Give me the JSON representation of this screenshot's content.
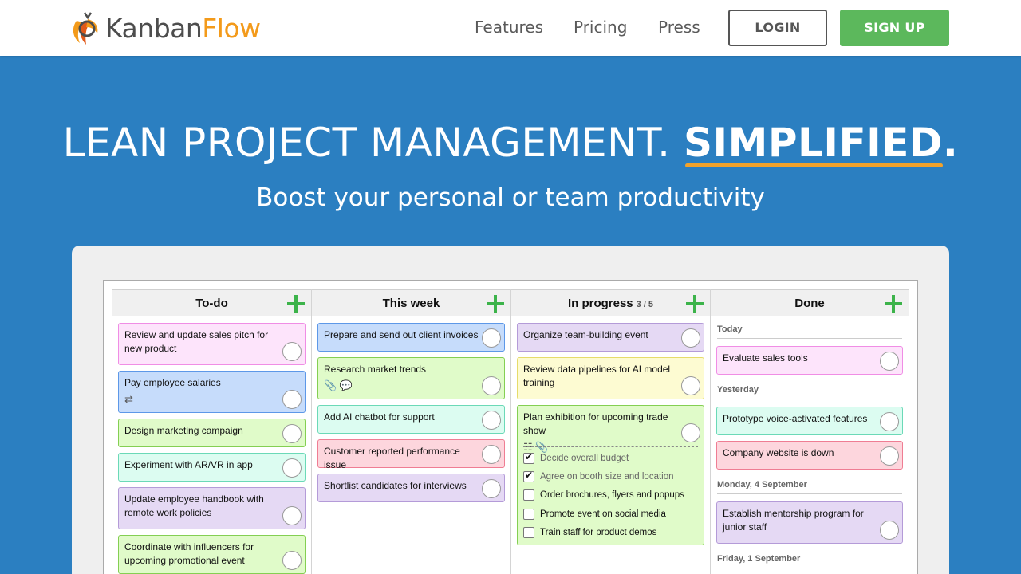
{
  "header": {
    "brand_part1": "Kanban",
    "brand_part2": "Flow",
    "nav": [
      "Features",
      "Pricing",
      "Press"
    ],
    "login_label": "LOGIN",
    "signup_label": "SIGN UP"
  },
  "hero": {
    "title_main": "LEAN PROJECT MANAGEMENT.",
    "title_strong": "SIMPLIFIED",
    "title_end": ".",
    "subtitle": "Boost your personal or team productivity"
  },
  "board": {
    "columns": [
      {
        "title": "To-do",
        "cards": [
          {
            "text": "Review and update sales pitch for new product",
            "color": "pink"
          },
          {
            "text": "Pay employee salaries",
            "color": "blue",
            "icons": "repeat"
          },
          {
            "text": "Design marketing campaign",
            "color": "green"
          },
          {
            "text": "Experiment with AR/VR in app",
            "color": "teal"
          },
          {
            "text": "Update employee handbook with remote work policies",
            "color": "purple"
          },
          {
            "text": "Coordinate with influencers for upcoming promotional event",
            "color": "green"
          }
        ]
      },
      {
        "title": "This week",
        "cards": [
          {
            "text": "Prepare and send out client invoices",
            "color": "blue"
          },
          {
            "text": "Research market trends",
            "color": "green",
            "icons": "attachment,comment"
          },
          {
            "text": "Add AI chatbot for support",
            "color": "teal"
          },
          {
            "text": "Customer reported performance issue",
            "color": "red"
          },
          {
            "text": "Shortlist candidates for interviews",
            "color": "purple"
          }
        ]
      },
      {
        "title": "In progress",
        "count": "3 / 5",
        "cards": [
          {
            "text": "Organize team-building event",
            "color": "purple"
          },
          {
            "text": "Review data pipelines for AI model training",
            "color": "yellow"
          },
          {
            "text": "Plan exhibition for upcoming trade show",
            "color": "green",
            "icons": "checklist,attachment"
          }
        ],
        "subtasks": [
          {
            "text": "Decide overall budget",
            "done": true
          },
          {
            "text": "Agree on booth size and location",
            "done": true
          },
          {
            "text": "Order brochures, flyers and popups",
            "done": false
          },
          {
            "text": "Promote event on social media",
            "done": false
          },
          {
            "text": "Train staff for product demos",
            "done": false
          }
        ]
      },
      {
        "title": "Done",
        "groups": [
          {
            "label": "Today",
            "cards": [
              {
                "text": "Evaluate sales tools",
                "color": "pink"
              }
            ]
          },
          {
            "label": "Yesterday",
            "cards": [
              {
                "text": "Prototype voice-activated features",
                "color": "teal"
              },
              {
                "text": "Company website is down",
                "color": "red"
              }
            ]
          },
          {
            "label": "Monday, 4 September",
            "cards": [
              {
                "text": "Establish mentorship program for junior staff",
                "color": "purple"
              }
            ]
          },
          {
            "label": "Friday, 1 September",
            "cards": []
          }
        ]
      }
    ]
  },
  "colors": {
    "hero_bg": "#2b7fc1",
    "accent_orange": "#f39a1a",
    "signup_green": "#5cb85c",
    "add_green": "#3cb34a"
  }
}
